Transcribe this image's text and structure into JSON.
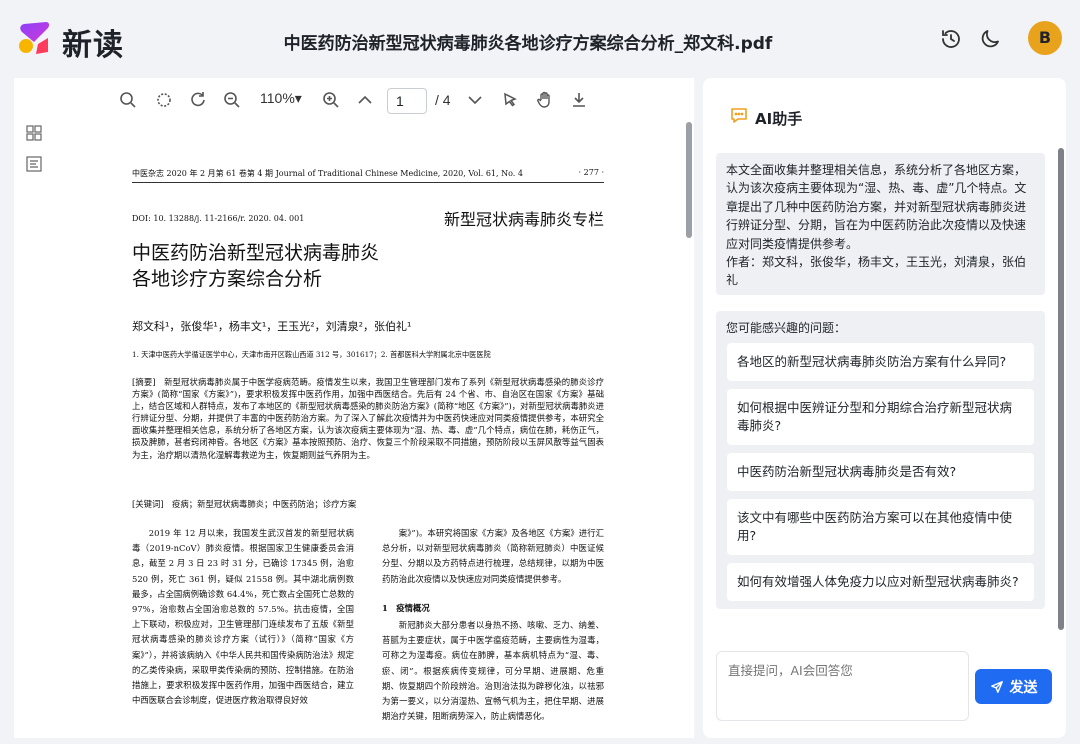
{
  "header": {
    "brand": "新读",
    "doc_title": "中医药防治新型冠状病毒肺炎各地诊疗方案综合分析_郑文科.pdf",
    "avatar_letter": "B"
  },
  "viewer": {
    "zoom": "110%▾",
    "page_current": "1",
    "page_total": "/ 4"
  },
  "paper": {
    "journal_line": "中医杂志 2020 年 2 月第 61 卷第 4 期 Journal of Traditional Chinese Medicine, 2020, Vol. 61, No. 4",
    "page_no": "· 277 ·",
    "doi": "DOI: 10. 13288/j. 11-2166/r. 2020. 04. 001",
    "column": "新型冠状病毒肺炎专栏",
    "title_line1": "中医药防治新型冠状病毒肺炎",
    "title_line2": "各地诊疗方案综合分析",
    "authors": "郑文科¹，张俊华¹，杨丰文¹，王玉光²，刘清泉²，张伯礼¹",
    "affiliation": "1. 天津中医药大学循证医学中心，天津市南开区鞍山西道 312 号，301617；2. 首都医科大学附属北京中医医院",
    "abstract": "[摘要]　新型冠状病毒肺炎属于中医学疫病范畴。疫情发生以来，我国卫生管理部门发布了系列《新型冠状病毒感染的肺炎诊疗方案》(简称“国家《方案》”)，要求积极发挥中医药作用，加强中西医结合。先后有 24 个省、市、自治区在国家《方案》基础上，结合区域和人群特点，发布了本地区的《新型冠状病毒感染的肺炎防治方案》(简称“地区《方案》”)，对新型冠状病毒肺炎进行辨证分型、分期，并提供了丰富的中医药防治方案。为了深入了解此次疫情并为中医药快速应对同类疫情提供参考，本研究全面收集并整理相关信息，系统分析了各地区方案，认为该次疫病主要体现为“湿、热、毒、虚”几个特点，病位在肺，耗伤正气，损及脾肺，甚者窍闭神昏。各地区《方案》基本按照预防、治疗、恢复三个阶段采取不同措施，预防阶段以玉屏风散等益气固表为主，治疗期以清热化湿解毒救逆为主，恢复期则益气养阴为主。",
    "keywords": "[关键词]　疫病；新型冠状病毒肺炎；中医药防治；诊疗方案",
    "body_left": "2019 年 12 月以来，我国发生武汉首发的新型冠状病毒（2019-nCoV）肺炎疫情。根据国家卫生健康委员会消息，截至 2 月 3 日 23 时 31 分，已确诊 17345 例，治愈 520 例，死亡 361 例，疑似 21558 例。其中湖北病例数最多，占全国病例确诊数 64.4%，死亡数占全国死亡总数的 97%，治愈数占全国治愈总数的 57.5%。抗击疫情，全国上下联动，积极应对，卫生管理部门连续发布了五版《新型冠状病毒感染的肺炎诊疗方案（试行）》（简称“国家《方案》”），并将该病纳入《中华人民共和国传染病防治法》规定的乙类传染病，采取甲类传染病的预防、控制措施。在防治措施上，要求积极发挥中医药作用，加强中西医结合，建立中西医联合会诊制度，促进医疗救治取得良好效",
    "body_right": "案》”)。本研究将国家《方案》及各地区《方案》进行汇总分析，以对新型冠状病毒肺炎（简称新冠肺炎）中医证候分型、分期以及方药特点进行梳理，总结规律，以期为中医药防治此次疫情以及快速应对同类疫情提供参考。",
    "section_heading": "1　疫情概况",
    "body_right2": "新冠肺炎大部分患者以身热不扬、咳嗽、乏力、纳差、苔腻为主要症状，属于中医学瘟疫范畴，主要病性为湿毒，可称之为湿毒疫。病位在肺脾，基本病机特点为“湿、毒、瘀、闭”。根据疾病传变规律，可分早期、进展期、危重期、恢复期四个阶段辨治。治则治法拟为辟秽化浊，以祛邪为第一要义，以分消湿热、宣畅气机为主，把住早期、进展期治疗关键，阻断病势深入，防止病情恶化。"
  },
  "ai": {
    "title": "AI助手",
    "summary": "本文全面收集并整理相关信息，系统分析了各地区方案，认为该次疫病主要体现为“湿、热、毒、虚”几个特点。文章提出了几种中医药防治方案，并对新型冠状病毒肺炎进行辨证分型、分期，旨在为中医药防治此次疫情以及快速应对同类疫情提供参考。",
    "summary_authors": "作者：郑文科，张俊华，杨丰文，王玉光，刘清泉，张伯礼",
    "questions_label": "您可能感兴趣的问题：",
    "questions": [
      "各地区的新型冠状病毒肺炎防治方案有什么异同?",
      "如何根据中医辨证分型和分期综合治疗新型冠状病毒肺炎?",
      "中医药防治新型冠状病毒肺炎是否有效?",
      "该文中有哪些中医药防治方案可以在其他疫情中使用?",
      "如何有效增强人体免疫力以应对新型冠状病毒肺炎?"
    ],
    "input_placeholder": "直接提问，AI会回答您",
    "send_label": "发送"
  },
  "colors": {
    "accent": "#1f6bf2",
    "avatar": "#e8a21b",
    "ai_icon": "#f0a020",
    "panel_bg": "#eef0f3"
  }
}
